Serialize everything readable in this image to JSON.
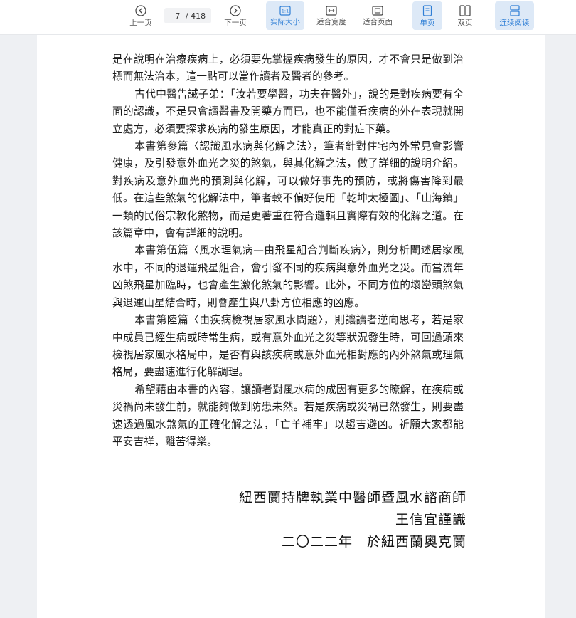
{
  "toolbar": {
    "prev_label": "上一页",
    "next_label": "下一页",
    "current_page": "7",
    "total_pages": "/ 418",
    "actual_size_label": "实际大小",
    "fit_width_label": "适合宽度",
    "fit_page_label": "适合页面",
    "single_page_label": "单页",
    "double_page_label": "双页",
    "continuous_label": "连续阅读",
    "accent_color": "#2f7fd6"
  },
  "document": {
    "paragraphs": [
      "是在說明在治療疾病上，必須要先掌握疾病發生的原因，才不會只是做到治標而無法治本，這一點可以當作讀者及醫者的參考。",
      "古代中醫告誡子弟：「汝若要學醫，功夫在醫外」，說的是對疾病要有全面的認識，不是只會讀醫書及開藥方而已，也不能僅看疾病的外在表現就開立處方，必須要探求疾病的發生原因，才能真正的對症下藥。",
      "本書第參篇〈認識風水病與化解之法〉，筆者針對住宅內外常見會影響健康，及引發意外血光之災的煞氣，與其化解之法，做了詳細的說明介紹。對疾病及意外血光的預測與化解，可以做好事先的預防，或將傷害降到最低。在這些煞氣的化解法中，筆者較不偏好使用「乾坤太極圖」、「山海鎮」一類的民俗宗教化煞物，而是更著重在符合邏輯且實際有效的化解之道。在該篇章中，會有詳細的說明。",
      "本書第伍篇〈風水理氣病—由飛星組合判斷疾病〉，則分析闡述居家風水中，不同的退運飛星組合，會引發不同的疾病與意外血光之災。而當流年凶煞飛星加臨時，也會產生激化煞氣的影響。此外，不同方位的壞巒頭煞氣與退運山星結合時，則會產生與八卦方位相應的凶應。",
      "本書第陸篇〈由疾病檢視居家風水問題〉，則讓讀者逆向思考，若是家中成員已經生病或時常生病，或有意外血光之災等狀況發生時，可回過頭來檢視居家風水格局中，是否有與該疾病或意外血光相對應的內外煞氣或理氣格局，要盡速進行化解調理。",
      "希望藉由本書的內容，讓讀者對風水病的成因有更多的瞭解，在疾病或災禍尚未發生前，就能夠做到防患未然。若是疾病或災禍已然發生，則要盡速透過風水煞氣的正確化解之法，「亡羊補牢」以趨吉避凶。祈願大家都能平安吉祥，離苦得樂。"
    ],
    "signature_line1": "紐西蘭持牌執業中醫師暨風水諮商師",
    "signature_line2": "王信宜謹識",
    "signature_line3": "二〇二二年　於紐西蘭奧克蘭"
  }
}
